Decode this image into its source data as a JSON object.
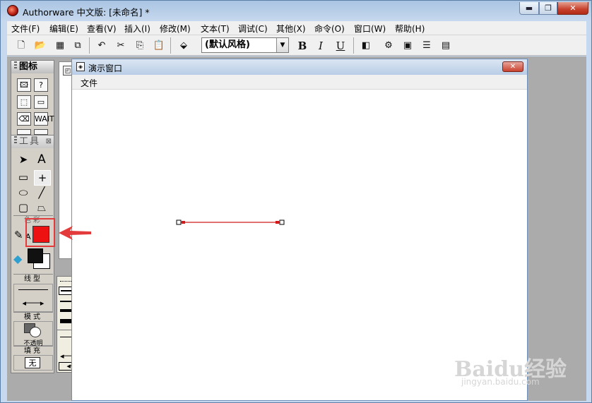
{
  "window": {
    "title": "Authorware 中文版: [未命名] *",
    "min": "▬",
    "max": "❐",
    "close": "✕"
  },
  "menubar": {
    "items": [
      "文件(F)",
      "编辑(E)",
      "查看(V)",
      "插入(I)",
      "修改(M)",
      "文本(T)",
      "调试(C)",
      "其他(X)",
      "命令(O)",
      "窗口(W)",
      "帮助(H)"
    ]
  },
  "toolbar": {
    "style_value": "(默认风格)",
    "bold": "B",
    "italic": "I",
    "underline": "U"
  },
  "icon_palette": {
    "title": "图标",
    "icons": [
      "显示",
      "交互",
      "运算",
      "判断",
      "擦除",
      "计算",
      "等待",
      "视频"
    ]
  },
  "tools_palette": {
    "title": "工具",
    "text_tool": "A",
    "color_label": "色彩",
    "color_text_marker": "A",
    "line_label": "线型",
    "mode_label": "模式",
    "mode_value": "不透明",
    "fill_label": "填充",
    "fill_value": "无",
    "colors": {
      "line": "#ee1111",
      "fill_fore": "#111111",
      "fill_back": "#ffffff"
    }
  },
  "presentation_window": {
    "title": "演示窗口",
    "menu_file": "文件",
    "close": "✕",
    "line_color": "#d21a1a"
  },
  "annotation": {
    "color": "#e33b3b"
  },
  "watermark": {
    "text": "Baidu经验",
    "sub": "jingyan.baidu.com"
  }
}
